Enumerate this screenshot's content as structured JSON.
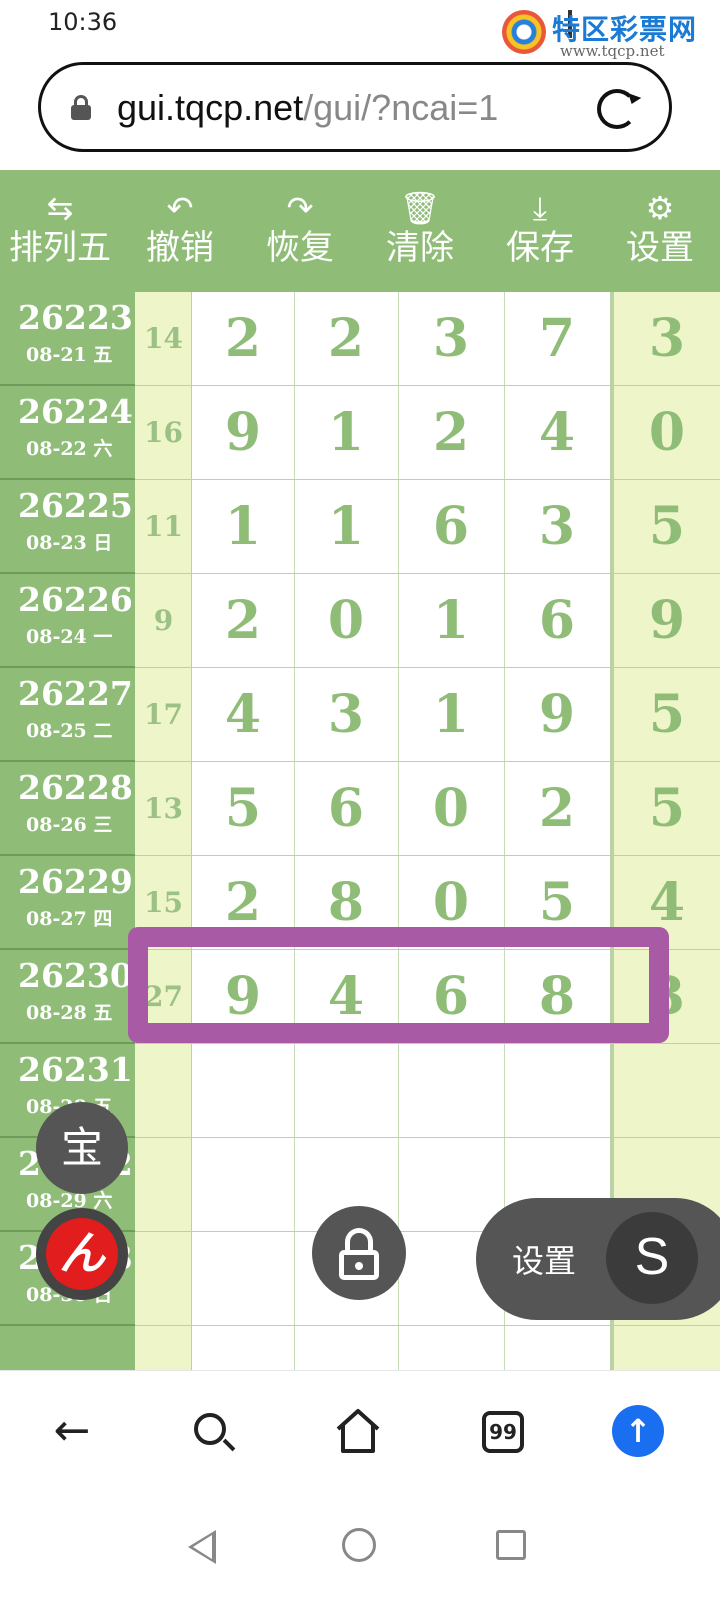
{
  "status_bar": {
    "time": "10:36"
  },
  "watermark": {
    "name": "特区彩票网",
    "url": "www.tqcp.net"
  },
  "address_bar": {
    "host": "gui.tqcp.net",
    "path": "/gui/?ncai=1"
  },
  "toolbar": {
    "items": [
      {
        "icon": "swap-icon",
        "glyph": "⇆",
        "label": "排列五"
      },
      {
        "icon": "undo-icon",
        "glyph": "↶",
        "label": "撤销"
      },
      {
        "icon": "redo-icon",
        "glyph": "↷",
        "label": "恢复"
      },
      {
        "icon": "trash-icon",
        "glyph": "🗑",
        "label": "清除"
      },
      {
        "icon": "download-icon",
        "glyph": "⤓",
        "label": "保存"
      },
      {
        "icon": "gear-icon",
        "glyph": "⚙",
        "label": "设置"
      }
    ]
  },
  "draws": {
    "rows": [
      {
        "period": "26223",
        "date": "08-21 五",
        "sum": "14",
        "digits": [
          "2",
          "2",
          "3",
          "7",
          "3"
        ]
      },
      {
        "period": "26224",
        "date": "08-22 六",
        "sum": "16",
        "digits": [
          "9",
          "1",
          "2",
          "4",
          "0"
        ]
      },
      {
        "period": "26225",
        "date": "08-23 日",
        "sum": "11",
        "digits": [
          "1",
          "1",
          "6",
          "3",
          "5"
        ]
      },
      {
        "period": "26226",
        "date": "08-24 一",
        "sum": "9",
        "digits": [
          "2",
          "0",
          "1",
          "6",
          "9"
        ]
      },
      {
        "period": "26227",
        "date": "08-25 二",
        "sum": "17",
        "digits": [
          "4",
          "3",
          "1",
          "9",
          "5"
        ]
      },
      {
        "period": "26228",
        "date": "08-26 三",
        "sum": "13",
        "digits": [
          "5",
          "6",
          "0",
          "2",
          "5"
        ]
      },
      {
        "period": "26229",
        "date": "08-27 四",
        "sum": "15",
        "digits": [
          "2",
          "8",
          "0",
          "5",
          "4"
        ]
      },
      {
        "period": "26230",
        "date": "08-28 五",
        "sum": "27",
        "digits": [
          "9",
          "4",
          "6",
          "8",
          "3"
        ]
      },
      {
        "period": "26231",
        "date": "08-28 五",
        "sum": "",
        "digits": [
          "",
          "",
          "",
          "",
          ""
        ]
      },
      {
        "period": "26232",
        "date": "08-29 六",
        "sum": "",
        "digits": [
          "",
          "",
          "",
          "",
          ""
        ]
      },
      {
        "period": "26233",
        "date": "08-30 日",
        "sum": "",
        "digits": [
          "",
          "",
          "",
          "",
          ""
        ]
      },
      {
        "period": "",
        "date": "",
        "sum": "",
        "digits": [
          "",
          "",
          "",
          "",
          ""
        ]
      }
    ]
  },
  "floating": {
    "bao_label": "宝",
    "app_label": "ん",
    "settings_label": "设置",
    "s_label": "S"
  },
  "browser_nav": {
    "tabs_count": "99"
  },
  "colors": {
    "accent_green": "#8fbd78",
    "highlight_purple": "#a95aa4",
    "pale_yellow": "#eef6c9"
  }
}
